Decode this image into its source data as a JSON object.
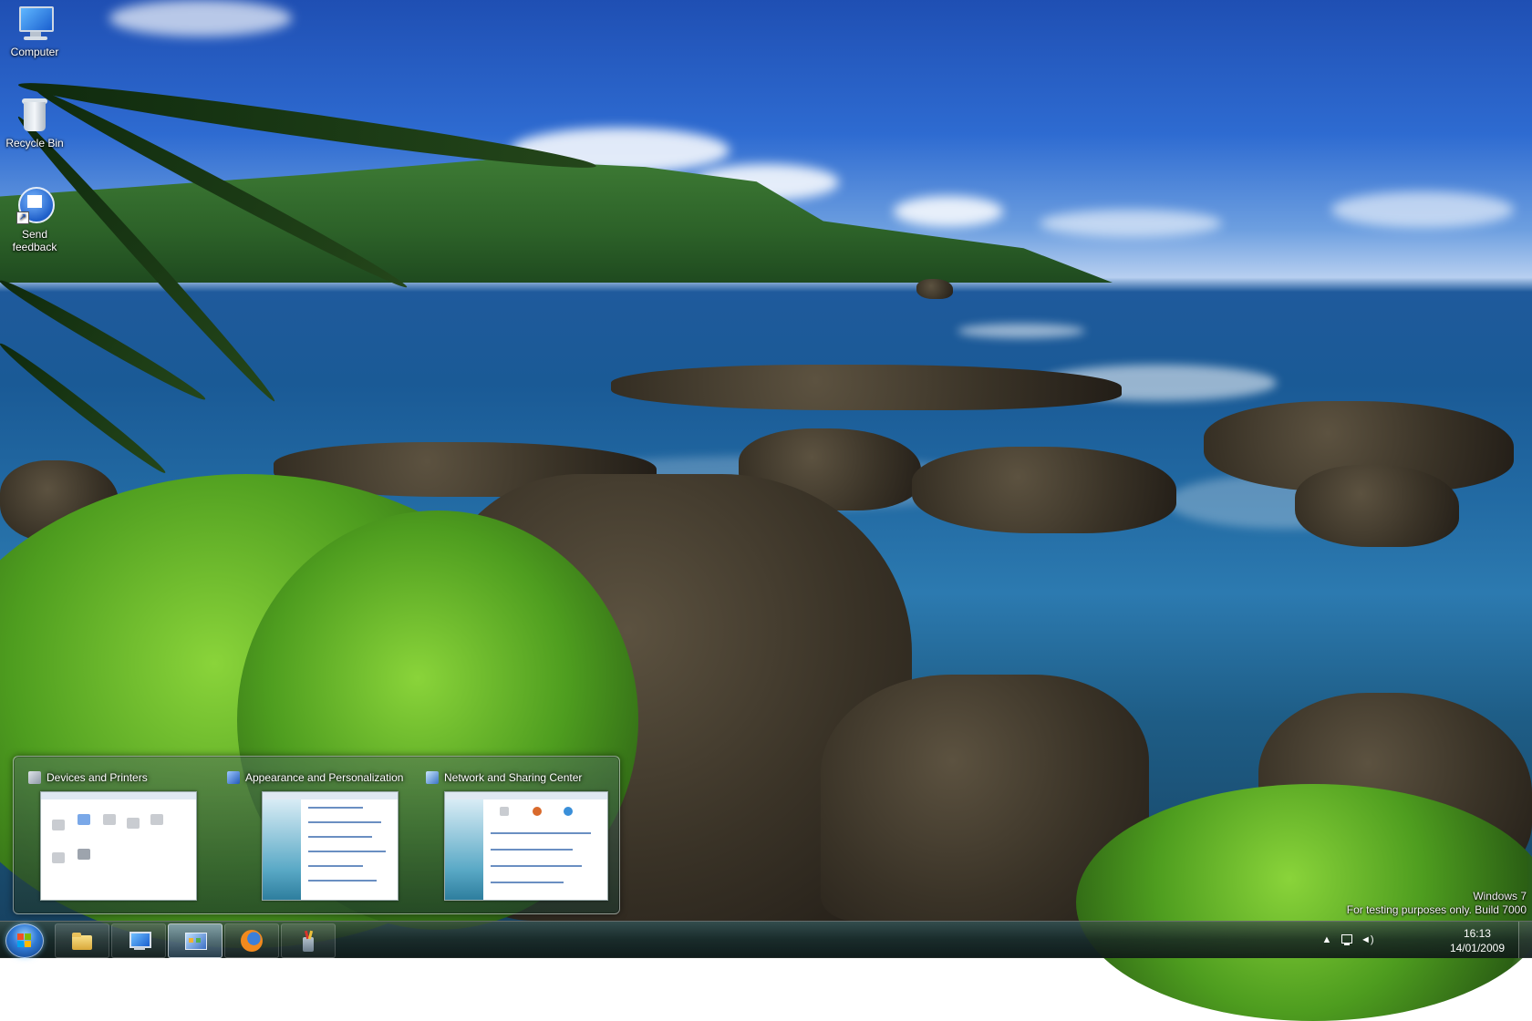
{
  "desktop": {
    "icons": [
      {
        "label": "Computer",
        "icon": "computer-icon"
      },
      {
        "label": "Recycle Bin",
        "icon": "recycle-bin-icon"
      },
      {
        "label": "Send feedback",
        "icon": "send-feedback-icon"
      }
    ]
  },
  "thumbnails": [
    {
      "title": "Devices and Printers",
      "icon": "devices-printers-icon"
    },
    {
      "title": "Appearance and Personalization",
      "icon": "appearance-personalization-icon"
    },
    {
      "title": "Network and Sharing Center",
      "icon": "network-sharing-icon"
    }
  ],
  "watermark": {
    "line1": "Windows 7",
    "line2": "For testing purposes only. Build 7000"
  },
  "taskbar": {
    "start_icon": "windows-flag-icon",
    "buttons": [
      {
        "icon": "explorer-folder-icon"
      },
      {
        "icon": "computer-icon"
      },
      {
        "icon": "control-panel-icon",
        "active": true
      },
      {
        "icon": "firefox-icon"
      },
      {
        "icon": "cleaner-tool-icon"
      }
    ],
    "tray": {
      "icons": [
        "show-hidden-icons-icon",
        "network-icon",
        "volume-icon"
      ],
      "time": "16:13",
      "date": "14/01/2009"
    }
  },
  "colors": {
    "accent": "#2f79d4",
    "taskbar": "#1a2a25"
  }
}
